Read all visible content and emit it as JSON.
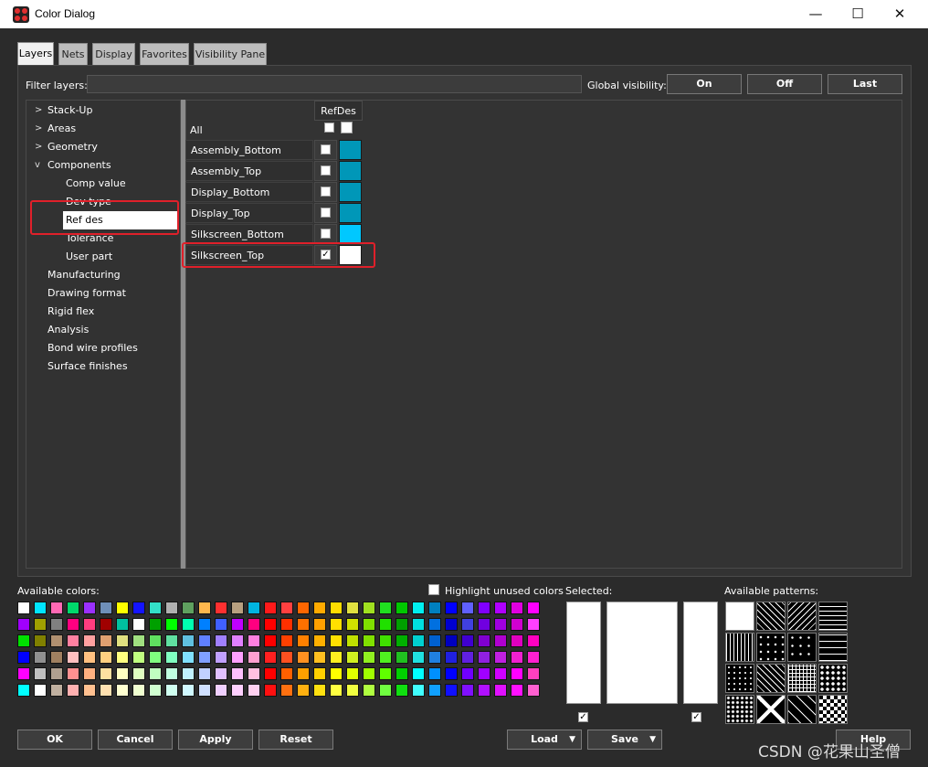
{
  "window": {
    "title": "Color Dialog",
    "minimize": "—",
    "maximize": "☐",
    "close": "✕"
  },
  "tabs": [
    "Layers",
    "Nets",
    "Display",
    "Favorites",
    "Visibility Pane"
  ],
  "filter": {
    "label": "Filter layers:",
    "value": ""
  },
  "global_visibility": {
    "label": "Global visibility:",
    "on": "On",
    "off": "Off",
    "last": "Last"
  },
  "tree": {
    "items": [
      {
        "label": "Stack-Up",
        "chevron": ">"
      },
      {
        "label": "Areas",
        "chevron": ">"
      },
      {
        "label": "Geometry",
        "chevron": ">"
      },
      {
        "label": "Components",
        "chevron": "v"
      },
      {
        "label": "Comp value"
      },
      {
        "label": "Dev type"
      },
      {
        "label": "Ref des"
      },
      {
        "label": "Tolerance"
      },
      {
        "label": "User part"
      },
      {
        "label": "Manufacturing"
      },
      {
        "label": "Drawing format"
      },
      {
        "label": "Rigid flex"
      },
      {
        "label": "Analysis"
      },
      {
        "label": "Bond wire profiles"
      },
      {
        "label": "Surface finishes"
      }
    ],
    "selected": "Ref des"
  },
  "grid": {
    "column_header": "RefDes",
    "all_label": "All",
    "rows": [
      {
        "label": "Assembly_Bottom",
        "checked": false,
        "color": "#0097b8"
      },
      {
        "label": "Assembly_Top",
        "checked": false,
        "color": "#0097b8"
      },
      {
        "label": "Display_Bottom",
        "checked": false,
        "color": "#0097b8"
      },
      {
        "label": "Display_Top",
        "checked": false,
        "color": "#0097b8"
      },
      {
        "label": "Silkscreen_Bottom",
        "checked": false,
        "color": "#00c8ff"
      },
      {
        "label": "Silkscreen_Top",
        "checked": true,
        "color": "#ffffff"
      }
    ],
    "check_glyph": "✓"
  },
  "available_colors_label": "Available colors:",
  "highlight_unused_label": "Highlight unused colors",
  "selected_label": "Selected:",
  "available_patterns_label": "Available patterns:",
  "palette": [
    [
      "#ffffff",
      "#00e5ff",
      "#ff69b4",
      "#00d96b",
      "#9b30ff",
      "#6f8fb8",
      "#ffff00",
      "#1414ff",
      "#33e0c8",
      "#b0b0b0",
      "#5fa05f",
      "#ffb84d",
      "#ff3030",
      "#b8a080",
      "#00b4e0",
      "#ff1a1a",
      "#ff4040",
      "#ff6600",
      "#ffaa00",
      "#ffdd00",
      "#e0e040",
      "#a0e020",
      "#20e020",
      "#00c800",
      "#00f0f0",
      "#0080c0",
      "#0000ff",
      "#6060ff",
      "#8000ff",
      "#b000ff",
      "#e000e0",
      "#ff00ff"
    ],
    [
      "#a000ff",
      "#a0a000",
      "#808080",
      "#ff0080",
      "#ff3d7f",
      "#a00000",
      "#00c0a0",
      "#ffffff",
      "#00a000",
      "#00ff00",
      "#00ffb0",
      "#0080ff",
      "#4060ff",
      "#c000ff",
      "#ff0080",
      "#ff0000",
      "#ff3000",
      "#ff7000",
      "#ffa000",
      "#ffe000",
      "#d0e000",
      "#80e000",
      "#20e000",
      "#00a000",
      "#00e0e0",
      "#0070e0",
      "#0000d0",
      "#4040e0",
      "#7000e0",
      "#a000e0",
      "#d000d0",
      "#ff40ff"
    ],
    [
      "#00e000",
      "#808000",
      "#b09070",
      "#ff80a0",
      "#ffa0a0",
      "#e0a070",
      "#e0e080",
      "#a0e080",
      "#60e060",
      "#60e0a0",
      "#60c0e0",
      "#6080ff",
      "#a080ff",
      "#e080ff",
      "#ff80e0",
      "#ff0000",
      "#ff4000",
      "#ff8000",
      "#ffb000",
      "#ffe000",
      "#c0e000",
      "#80e000",
      "#40e000",
      "#00b000",
      "#00d0d0",
      "#0060d0",
      "#0000c0",
      "#4000d0",
      "#8000d0",
      "#b000d0",
      "#e000c0",
      "#ff00c0"
    ],
    [
      "#0000ff",
      "#909090",
      "#a08060",
      "#ffc0c0",
      "#ffc080",
      "#ffd080",
      "#ffff80",
      "#c0ff80",
      "#80ff80",
      "#80ffc0",
      "#80e0ff",
      "#80a0ff",
      "#c0a0ff",
      "#ffa0ff",
      "#ffa0d0",
      "#ff2020",
      "#ff5020",
      "#ff9020",
      "#ffc020",
      "#fff020",
      "#d0f020",
      "#90f020",
      "#50f020",
      "#20c020",
      "#20e0e0",
      "#2080e0",
      "#2020e0",
      "#6020e0",
      "#9020e0",
      "#c020e0",
      "#f020d0",
      "#ff20d0"
    ],
    [
      "#ff00ff",
      "#c0c0c0",
      "#b0a090",
      "#ff9090",
      "#ffb080",
      "#ffe0a0",
      "#ffffc0",
      "#e0ffc0",
      "#c0ffc0",
      "#c0ffe0",
      "#c0f0ff",
      "#c0d0ff",
      "#e0c0ff",
      "#ffc0ff",
      "#ffc0e0",
      "#ff0000",
      "#ff6000",
      "#ffa000",
      "#ffd000",
      "#ffff00",
      "#e0ff00",
      "#a0ff00",
      "#60ff00",
      "#00d000",
      "#00ffff",
      "#0090ff",
      "#0000ff",
      "#7000ff",
      "#a000ff",
      "#d000ff",
      "#ff00ff",
      "#ff40c0"
    ],
    [
      "#00ffff",
      "#ffffff",
      "#c0b0a0",
      "#ffb0b0",
      "#ffc090",
      "#ffe0b0",
      "#ffffd0",
      "#f0ffd0",
      "#d0ffd0",
      "#d0fff0",
      "#d0f8ff",
      "#d0e0ff",
      "#f0d0ff",
      "#ffd0ff",
      "#ffd0f0",
      "#ff1010",
      "#ff7010",
      "#ffb010",
      "#ffe010",
      "#ffff40",
      "#f0ff40",
      "#b0ff40",
      "#70ff40",
      "#10e010",
      "#40ffff",
      "#10a0ff",
      "#1010ff",
      "#8010ff",
      "#b010ff",
      "#e010ff",
      "#ff10ff",
      "#ff60d0"
    ]
  ],
  "buttons": {
    "ok": "OK",
    "cancel": "Cancel",
    "apply": "Apply",
    "reset": "Reset",
    "load": "Load",
    "save": "Save",
    "help": "Help",
    "dropdown_glyph": "▼"
  },
  "watermark": "CSDN @花果山圣僧"
}
